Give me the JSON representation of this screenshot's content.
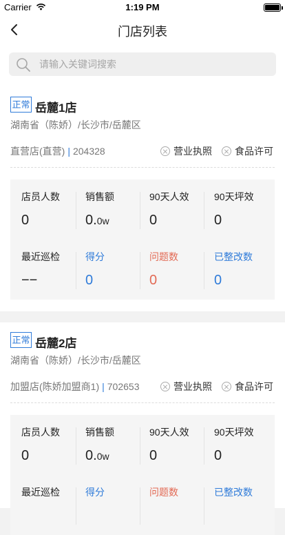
{
  "status_bar": {
    "carrier": "Carrier",
    "time": "1:19 PM"
  },
  "nav": {
    "title": "门店列表",
    "back_icon": "chevron-left-icon"
  },
  "search": {
    "placeholder": "请输入关键词搜索",
    "value": ""
  },
  "colors": {
    "accent_blue": "#2f7bd9",
    "problem_red": "#e26a55"
  },
  "stores": [
    {
      "status": "正常",
      "name": "岳麓1店",
      "address": "湖南省（陈娇）/长沙市/岳麓区",
      "type": "直营店(直营)",
      "separator": "|",
      "code": "204328",
      "license1": "营业执照",
      "license2": "食品许可",
      "stats": {
        "staff_label": "店员人数",
        "staff_value": "0",
        "sales_label": "销售额",
        "sales_value": "0.",
        "sales_unit": "0w",
        "eff90_label": "90天人效",
        "eff90_value": "0",
        "area90_label": "90天坪效",
        "area90_value": "0",
        "inspect_label": "最近巡检",
        "inspect_value": "−−",
        "score_label": "得分",
        "score_value": "0",
        "issues_label": "问题数",
        "issues_value": "0",
        "fixed_label": "已整改数",
        "fixed_value": "0"
      }
    },
    {
      "status": "正常",
      "name": "岳麓2店",
      "address": "湖南省（陈娇）/长沙市/岳麓区",
      "type": "加盟店(陈娇加盟商1)",
      "separator": "|",
      "code": "702653",
      "license1": "营业执照",
      "license2": "食品许可",
      "stats": {
        "staff_label": "店员人数",
        "staff_value": "0",
        "sales_label": "销售额",
        "sales_value": "0.",
        "sales_unit": "0w",
        "eff90_label": "90天人效",
        "eff90_value": "0",
        "area90_label": "90天坪效",
        "area90_value": "0",
        "inspect_label": "最近巡检",
        "score_label": "得分",
        "issues_label": "问题数",
        "fixed_label": "已整改数"
      }
    }
  ]
}
